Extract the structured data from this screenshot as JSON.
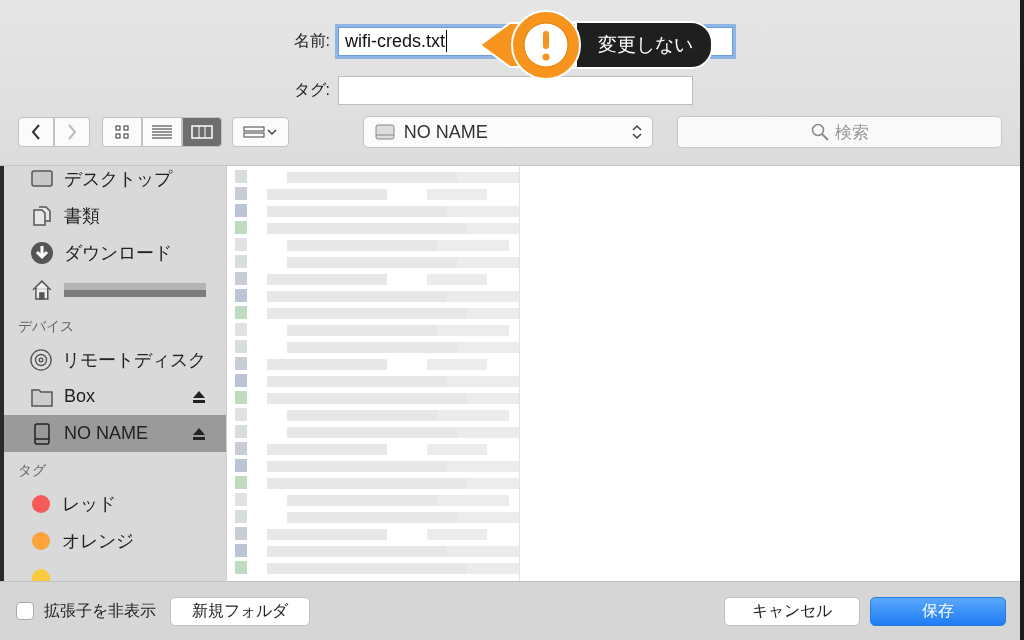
{
  "name_field": {
    "label": "名前:",
    "value": "wifi-creds.txt"
  },
  "warning_popover": {
    "text": "変更しない"
  },
  "tag_field": {
    "label": "タグ:"
  },
  "toolbar": {
    "view_modes": [
      {
        "kind": "icons",
        "selected": false
      },
      {
        "kind": "list",
        "selected": false
      },
      {
        "kind": "columns",
        "selected": true
      }
    ],
    "location": "NO NAME",
    "search": {
      "placeholder": "検索"
    }
  },
  "sidebar": {
    "sections": [
      {
        "items": [
          {
            "kind": "desktop",
            "label": "デスクトップ",
            "selected": false
          },
          {
            "kind": "document",
            "label": "書類",
            "selected": false
          },
          {
            "kind": "download",
            "label": "ダウンロード",
            "selected": false
          },
          {
            "kind": "home",
            "selected": false
          }
        ]
      },
      {
        "title": "デバイス",
        "items": [
          {
            "kind": "disc",
            "label": "リモートディスク",
            "selected": false
          },
          {
            "kind": "folder",
            "label": "Box",
            "eject": true,
            "selected": false
          },
          {
            "kind": "drive",
            "label": "NO NAME",
            "eject": true,
            "selected": true
          }
        ]
      },
      {
        "title": "タグ",
        "items": [
          {
            "kind": "tag",
            "label": "レッド",
            "color": "#f45b56",
            "selected": false
          },
          {
            "kind": "tag",
            "label": "オレンジ",
            "color": "#fca43a",
            "selected": false
          },
          {
            "kind": "tag",
            "color": "#f7cb3c",
            "selected": false
          }
        ]
      }
    ]
  },
  "browser": {
    "first_column": {
      "kind": "redacted"
    }
  },
  "footer": {
    "hide_extension": {
      "label": "拡張子を非表示",
      "checked": false
    },
    "new_folder": "新規フォルダ",
    "cancel": "キャンセル",
    "save": "保存"
  }
}
